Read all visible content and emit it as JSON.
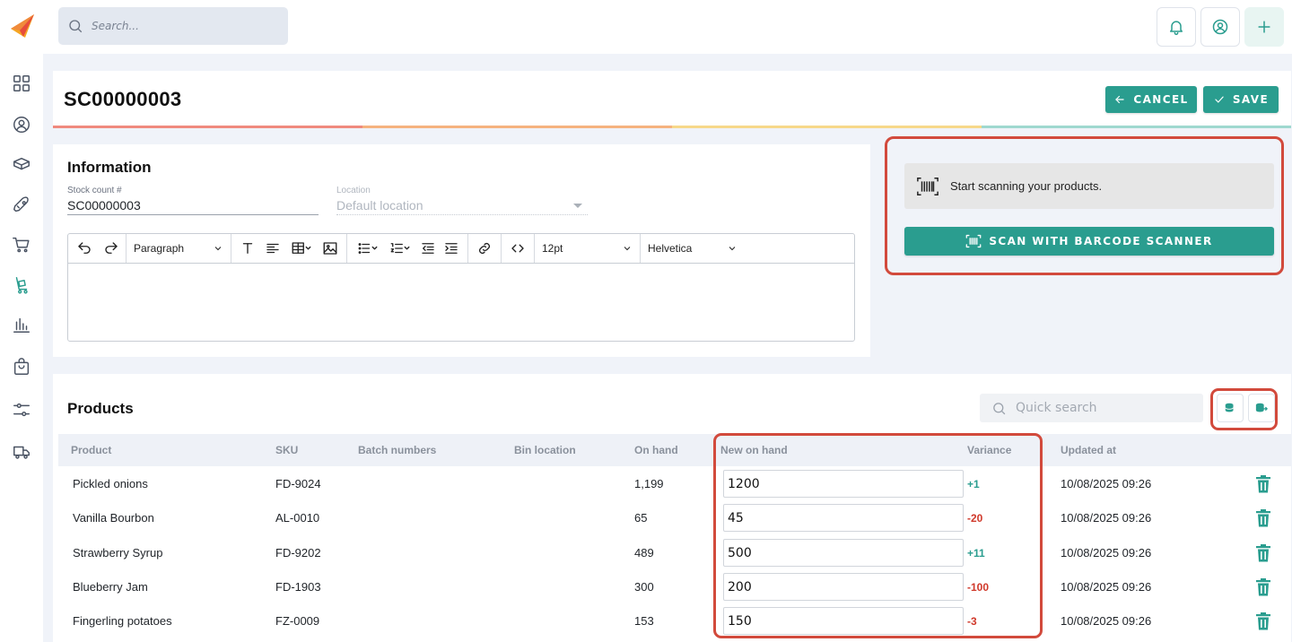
{
  "sidebar": {
    "icons": [
      "dashboard-icon",
      "user-circle-icon",
      "box-icon",
      "rocket-icon",
      "cart-icon",
      "stock-count-icon",
      "bar-chart-icon",
      "bag-icon",
      "sliders-icon",
      "truck-icon"
    ],
    "active": "stock-count-icon"
  },
  "topbar": {
    "search_placeholder": "Search...",
    "buttons": [
      "bell-icon",
      "account-icon",
      "plus-icon"
    ]
  },
  "header": {
    "title": "SC00000003",
    "cancel_label": "CANCEL",
    "save_label": "SAVE"
  },
  "colors": {
    "accent": "#2a9d8f",
    "highlight": "#d24a3c",
    "negative": "#d0392b",
    "strip": [
      "#f08a7e",
      "#f5b27f",
      "#f7d88a",
      "#9fd8cf"
    ]
  },
  "information": {
    "title": "Information",
    "stock_count_label": "Stock count #",
    "stock_count_value": "SC00000003",
    "location_label": "Location",
    "location_value": "Default location",
    "editor": {
      "paragraph_select": "Paragraph",
      "font_size_select": "12pt",
      "font_family_select": "Helvetica"
    }
  },
  "scanner": {
    "message": "Start scanning your products.",
    "button_label": "SCAN WITH BARCODE SCANNER"
  },
  "products": {
    "title": "Products",
    "quick_search_placeholder": "Quick search",
    "columns": {
      "product": "Product",
      "sku": "SKU",
      "batch": "Batch numbers",
      "bin": "Bin location",
      "on_hand": "On hand",
      "new_on_hand": "New on hand",
      "variance": "Variance",
      "updated_at": "Updated at"
    },
    "rows": [
      {
        "product": "Pickled onions",
        "sku": "FD-9024",
        "on_hand": "1,199",
        "new_on_hand": "1200",
        "variance": "+1",
        "updated_at": "10/08/2025 09:26"
      },
      {
        "product": "Vanilla Bourbon",
        "sku": "AL-0010",
        "on_hand": "65",
        "new_on_hand": "45",
        "variance": "-20",
        "updated_at": "10/08/2025 09:26"
      },
      {
        "product": "Strawberry Syrup",
        "sku": "FD-9202",
        "on_hand": "489",
        "new_on_hand": "500",
        "variance": "+11",
        "updated_at": "10/08/2025 09:26"
      },
      {
        "product": "Blueberry Jam",
        "sku": "FD-1903",
        "on_hand": "300",
        "new_on_hand": "200",
        "variance": "-100",
        "updated_at": "10/08/2025 09:26"
      },
      {
        "product": "Fingerling potatoes",
        "sku": "FZ-0009",
        "on_hand": "153",
        "new_on_hand": "150",
        "variance": "-3",
        "updated_at": "10/08/2025 09:26"
      }
    ]
  }
}
